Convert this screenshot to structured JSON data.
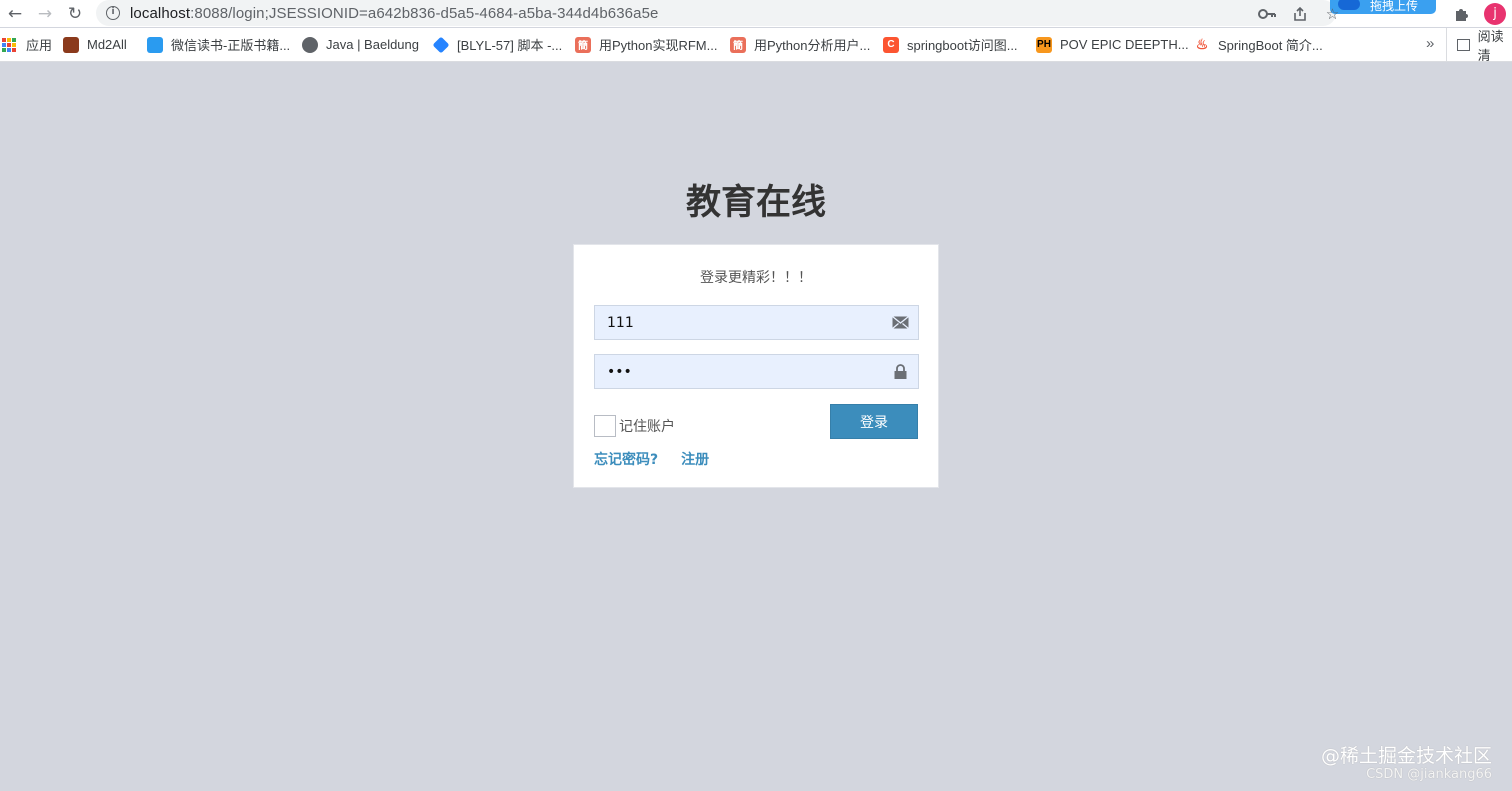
{
  "browser": {
    "url_host": "localhost",
    "url_rest": ":8088/login;JSESSIONID=a642b836-d5a5-4684-a5ba-344d4b636a5e",
    "extension_label": "拖拽上传",
    "profile_initial": "j"
  },
  "bookmarks": {
    "items": [
      {
        "label": "应用",
        "icon": "apps-grid-icon"
      },
      {
        "label": "Md2All",
        "icon": "md2all-icon",
        "color": "#8b3a1c"
      },
      {
        "label": "微信读书-正版书籍...",
        "icon": "weread-icon",
        "color": "#2a9bf0"
      },
      {
        "label": "Java | Baeldung",
        "icon": "globe-icon",
        "color": "#5f6368"
      },
      {
        "label": "[BLYL-57] 脚本 -...",
        "icon": "jira-icon",
        "color": "#2684ff"
      },
      {
        "label": "用Python实现RFM...",
        "icon": "jianshu-icon",
        "color": "#ea6f5a"
      },
      {
        "label": "用Python分析用户...",
        "icon": "jianshu-icon",
        "color": "#ea6f5a"
      },
      {
        "label": "springboot访问图...",
        "icon": "csdn-icon",
        "color": "#fc5531"
      },
      {
        "label": "POV EPIC DEEPTH...",
        "icon": "ph-icon",
        "color": "#f7971d"
      },
      {
        "label": "SpringBoot 简介...",
        "icon": "flame-icon",
        "color": "#f0563a"
      }
    ],
    "more": "»",
    "reading_list": "阅读清"
  },
  "page": {
    "title": "教育在线",
    "subtitle": "登录更精彩！！！",
    "username_value": "111",
    "password_value": "•••",
    "remember_label": "记住账户",
    "login_label": "登录",
    "forgot_label": "忘记密码?",
    "register_label": "注册"
  },
  "watermark": {
    "line1": "@稀土掘金技术社区",
    "line2": "CSDN @jiankang66"
  },
  "colors": {
    "background": "#d3d6de",
    "primary": "#3c8dbc",
    "input_fill": "#e8f0fe"
  }
}
